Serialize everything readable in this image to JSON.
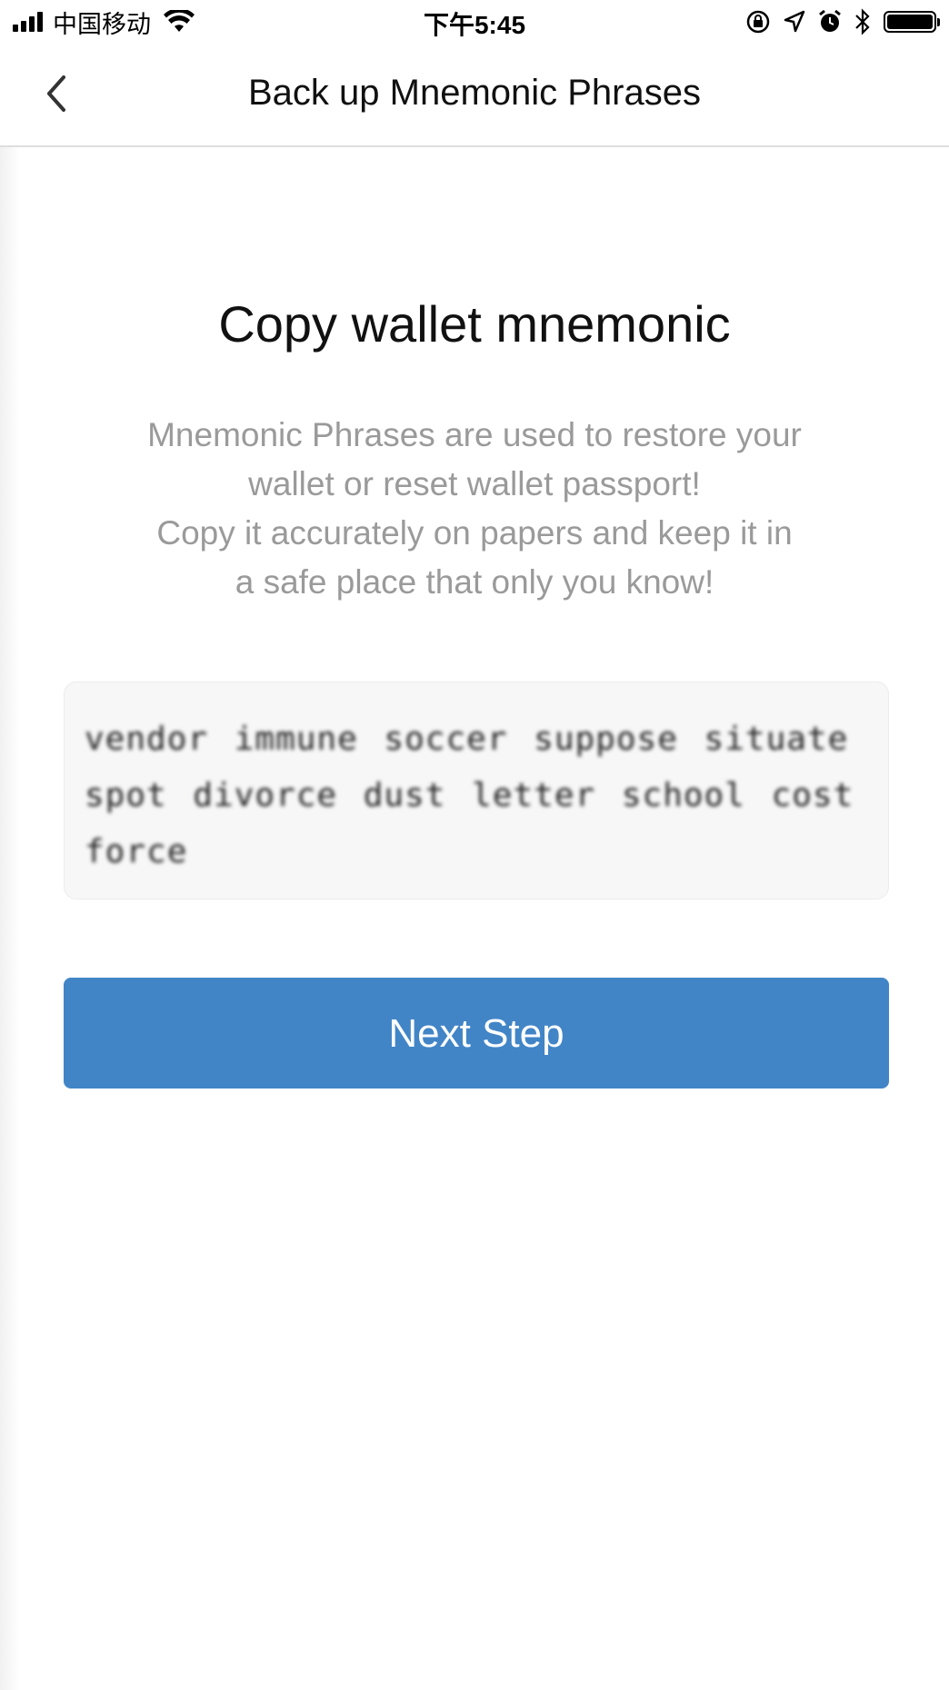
{
  "status_bar": {
    "carrier": "中国移动",
    "time": "下午5:45"
  },
  "nav": {
    "title": "Back up Mnemonic Phrases",
    "back_icon": "chevron-left-icon"
  },
  "main": {
    "headline": "Copy wallet mnemonic",
    "description_lines": [
      "Mnemonic Phrases are used to restore your",
      "wallet or reset wallet passport!",
      "Copy it accurately on papers and keep it in",
      "a safe place that only you know!"
    ],
    "mnemonic": "vendor immune soccer suppose situate spot divorce dust letter school cost force",
    "next_button_label": "Next Step"
  },
  "colors": {
    "accent": "#4185c7",
    "description_text": "#9a9a9a",
    "mnemonic_box_bg": "#f7f7f8"
  }
}
